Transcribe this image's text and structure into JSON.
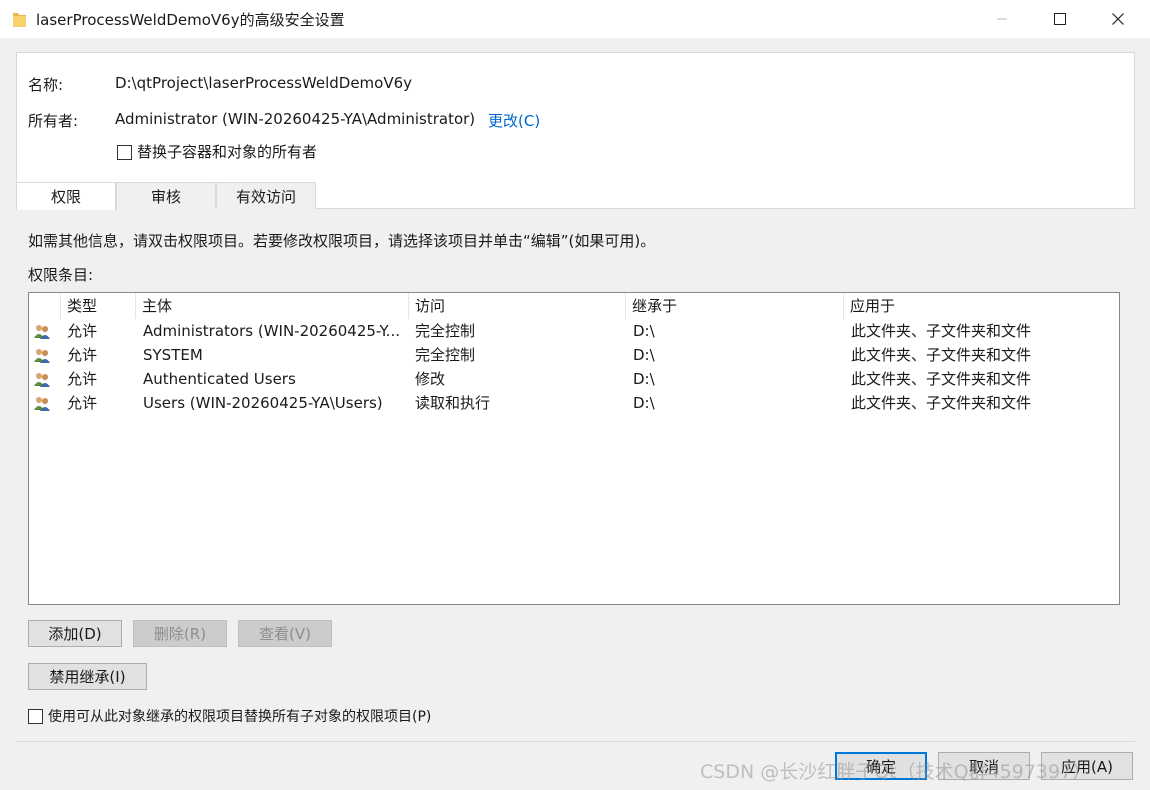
{
  "window": {
    "title": "laserProcessWeldDemoV6y的高级安全设置",
    "icon": "folder-icon",
    "controls": [
      "minimize-icon",
      "maximize-icon",
      "close-icon"
    ]
  },
  "info": {
    "name_label": "名称:",
    "name_value": "D:\\qtProject\\laserProcessWeldDemoV6y",
    "owner_label": "所有者:",
    "owner_value": "Administrator (WIN-20260425-YA\\Administrator)",
    "change_link": "更改(C)",
    "replace_owner_checkbox": "替换子容器和对象的所有者"
  },
  "tabs": [
    {
      "label": "权限",
      "active": true
    },
    {
      "label": "审核",
      "active": false
    },
    {
      "label": "有效访问",
      "active": false
    }
  ],
  "permissions": {
    "hint": "如需其他信息，请双击权限项目。若要修改权限项目，请选择该项目并单击“编辑”(如果可用)。",
    "entries_label": "权限条目:",
    "columns": [
      "类型",
      "主体",
      "访问",
      "继承于",
      "应用于"
    ],
    "rows": [
      {
        "type": "允许",
        "principal": "Administrators (WIN-20260425-Y...",
        "access": "完全控制",
        "inherited": "D:\\",
        "applies": "此文件夹、子文件夹和文件"
      },
      {
        "type": "允许",
        "principal": "SYSTEM",
        "access": "完全控制",
        "inherited": "D:\\",
        "applies": "此文件夹、子文件夹和文件"
      },
      {
        "type": "允许",
        "principal": "Authenticated Users",
        "access": "修改",
        "inherited": "D:\\",
        "applies": "此文件夹、子文件夹和文件"
      },
      {
        "type": "允许",
        "principal": "Users (WIN-20260425-YA\\Users)",
        "access": "读取和执行",
        "inherited": "D:\\",
        "applies": "此文件夹、子文件夹和文件"
      }
    ],
    "row_icon": "users-group-icon",
    "add_button": "添加(D)",
    "remove_button": "删除(R)",
    "view_button": "查看(V)",
    "disable_inheritance_button": "禁用继承(I)",
    "replace_child_checkbox": "使用可从此对象继承的权限项目替换所有子对象的权限项目(P)"
  },
  "footer": {
    "ok": "确定",
    "cancel": "取消",
    "apply": "应用(A)"
  },
  "watermark": "CSDN @长沙红胖子Qt（技术Q群4597397）",
  "colors": {
    "link": "#0066cc",
    "accent": "#0078d7"
  }
}
